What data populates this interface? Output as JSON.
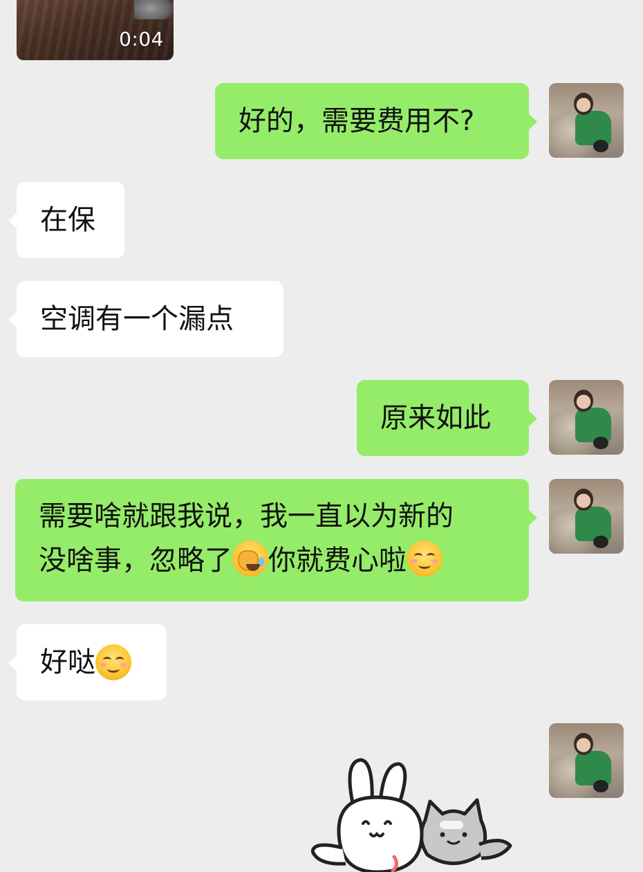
{
  "chat": {
    "video": {
      "duration": "0:04"
    },
    "messages": [
      {
        "id": "m1",
        "side": "out",
        "text": "好的，需要费用不?"
      },
      {
        "id": "m2",
        "side": "in",
        "text": "在保"
      },
      {
        "id": "m3",
        "side": "in",
        "text": "空调有一个漏点"
      },
      {
        "id": "m4",
        "side": "out",
        "text": "原来如此"
      },
      {
        "id": "m5",
        "side": "out",
        "line1": "需要啥就跟我说，我一直以为新的",
        "line2_a": "没啥事，忽略了",
        "line2_b": "你就费心啦",
        "emojis": [
          "facepalm-emoji",
          "smile-emoji"
        ]
      },
      {
        "id": "m6",
        "side": "in",
        "text": "好哒",
        "emojis": [
          "smile-emoji"
        ]
      },
      {
        "id": "m7",
        "side": "out",
        "sticker": "rabbit-and-cat-sticker"
      }
    ]
  },
  "colors": {
    "background": "#ededed",
    "outgoing_bubble": "#95ec69",
    "incoming_bubble": "#ffffff"
  }
}
